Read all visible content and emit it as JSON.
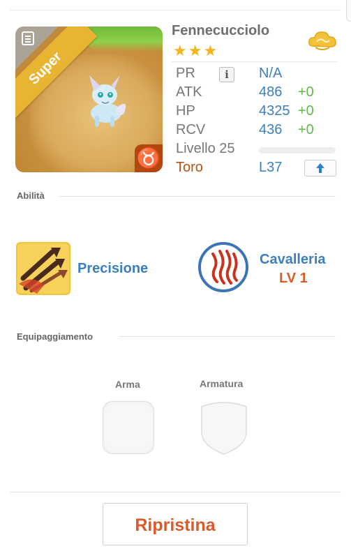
{
  "card": {
    "name": "Fennecucciolo",
    "stars": "★★★",
    "rarity_ribbon": "Super",
    "zodiac_symbol": "♉",
    "stats": {
      "pr_label": "PR",
      "pr_value": "N/A",
      "info_symbol": "i",
      "atk_label": "ATK",
      "atk_value": "486",
      "atk_bonus": "+0",
      "hp_label": "HP",
      "hp_value": "4325",
      "hp_bonus": "+0",
      "rcv_label": "RCV",
      "rcv_value": "436",
      "rcv_bonus": "+0",
      "level_label": "Livello 25",
      "level_progress": 0,
      "sign_label": "Toro",
      "sign_level": "L37"
    }
  },
  "abilities": {
    "header": "Abilità",
    "skill1_name": "Precisione",
    "skill2_name": "Cavalleria",
    "skill2_level": "LV 1"
  },
  "equipment": {
    "header": "Equipaggiamento",
    "weapon_label": "Arma",
    "armor_label": "Armatura"
  },
  "actions": {
    "reset_label": "Ripristina"
  },
  "colors": {
    "accent_blue": "#3b7fbf",
    "bonus_green": "#62b94a",
    "sign_orange": "#b85214",
    "reset_red": "#d95a2b",
    "ribbon_gold": "#e9b431"
  }
}
